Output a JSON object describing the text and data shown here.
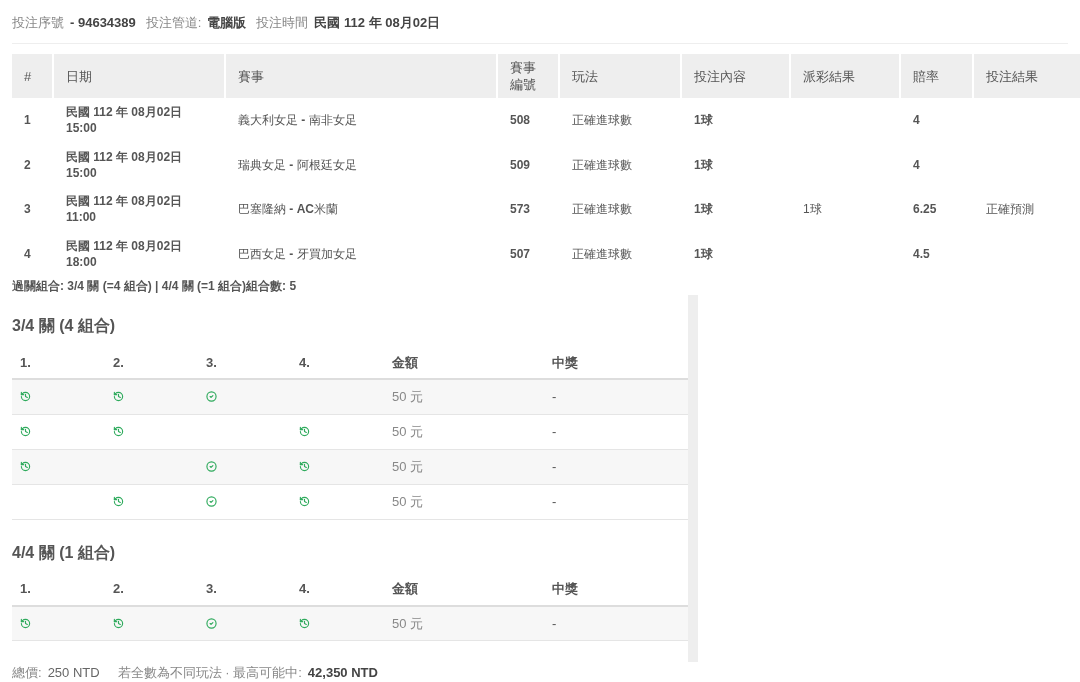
{
  "bet_info": [
    {
      "label": "投注序號",
      "value": "- 94634389"
    },
    {
      "label": "投注管道:",
      "value": "電腦版"
    },
    {
      "label": "投注時間",
      "value": "民國 112 年 08月02日"
    }
  ],
  "bets_table": {
    "columns": [
      "#",
      "日期",
      "賽事",
      "賽事編號",
      "玩法",
      "投注內容",
      "派彩結果",
      "賠率",
      "投注結果"
    ],
    "rows": [
      {
        "no": "1",
        "date": "民國 112 年 08月02日",
        "time": "15:00",
        "match": "義大利女足 **-** 南非女足",
        "match_id": "508",
        "play": "正確進球數",
        "pick": "1球",
        "odds": "4"
      },
      {
        "no": "2",
        "date": "民國 112 年 08月02日",
        "time": "15:00",
        "match": "瑞典女足 **-** 阿根廷女足",
        "match_id": "509",
        "play": "正確進球數",
        "pick": "1球",
        "odds": "4"
      },
      {
        "no": "3",
        "date": "民國 112 年 08月02日",
        "time": "11:00",
        "match": "巴塞隆納 **- AC**米蘭",
        "match_id": "573",
        "play": "正確進球數",
        "pick": "1球",
        "payout": "1球",
        "odds": "6.25",
        "result": "正確預測"
      },
      {
        "no": "4",
        "date": "民國 112 年 08月02日",
        "time": "18:00",
        "match": "巴西女足 **-** 牙買加女足",
        "match_id": "507",
        "play": "正確進球數",
        "pick": "1球",
        "odds": "4.5"
      }
    ]
  },
  "combo_summary": "過關組合: 3/4 關 (=4 組合) | 4/4 關 (=1 組合)組合數: 5",
  "combo_sections": [
    {
      "title": "3/4 關 (4 組合)",
      "columns": [
        "1.",
        "2.",
        "3.",
        "4.",
        "金額",
        "中獎"
      ],
      "rows": [
        {
          "legs": [
            {
              "kind": "pending"
            },
            {
              "kind": "pending"
            },
            {
              "kind": "won"
            },
            {
              "kind": "none"
            }
          ],
          "amount": "50 元",
          "prize": "-"
        },
        {
          "legs": [
            {
              "kind": "pending"
            },
            {
              "kind": "pending"
            },
            {
              "kind": "none"
            },
            {
              "kind": "pending"
            }
          ],
          "amount": "50 元",
          "prize": "-"
        },
        {
          "legs": [
            {
              "kind": "pending"
            },
            {
              "kind": "none"
            },
            {
              "kind": "won"
            },
            {
              "kind": "pending"
            }
          ],
          "amount": "50 元",
          "prize": "-"
        },
        {
          "legs": [
            {
              "kind": "none"
            },
            {
              "kind": "pending"
            },
            {
              "kind": "won"
            },
            {
              "kind": "pending"
            }
          ],
          "amount": "50 元",
          "prize": "-"
        }
      ]
    },
    {
      "title": "4/4 關 (1 組合)",
      "columns": [
        "1.",
        "2.",
        "3.",
        "4.",
        "金額",
        "中獎"
      ],
      "rows": [
        {
          "legs": [
            {
              "kind": "pending"
            },
            {
              "kind": "pending"
            },
            {
              "kind": "won"
            },
            {
              "kind": "pending"
            }
          ],
          "amount": "50 元",
          "prize": "-"
        }
      ]
    }
  ],
  "footer": {
    "total_label": "總價:",
    "total": "250 NTD",
    "max_label": "若全數為不同玩法 · 最高可能中:",
    "max_win": "42,350 NTD"
  }
}
